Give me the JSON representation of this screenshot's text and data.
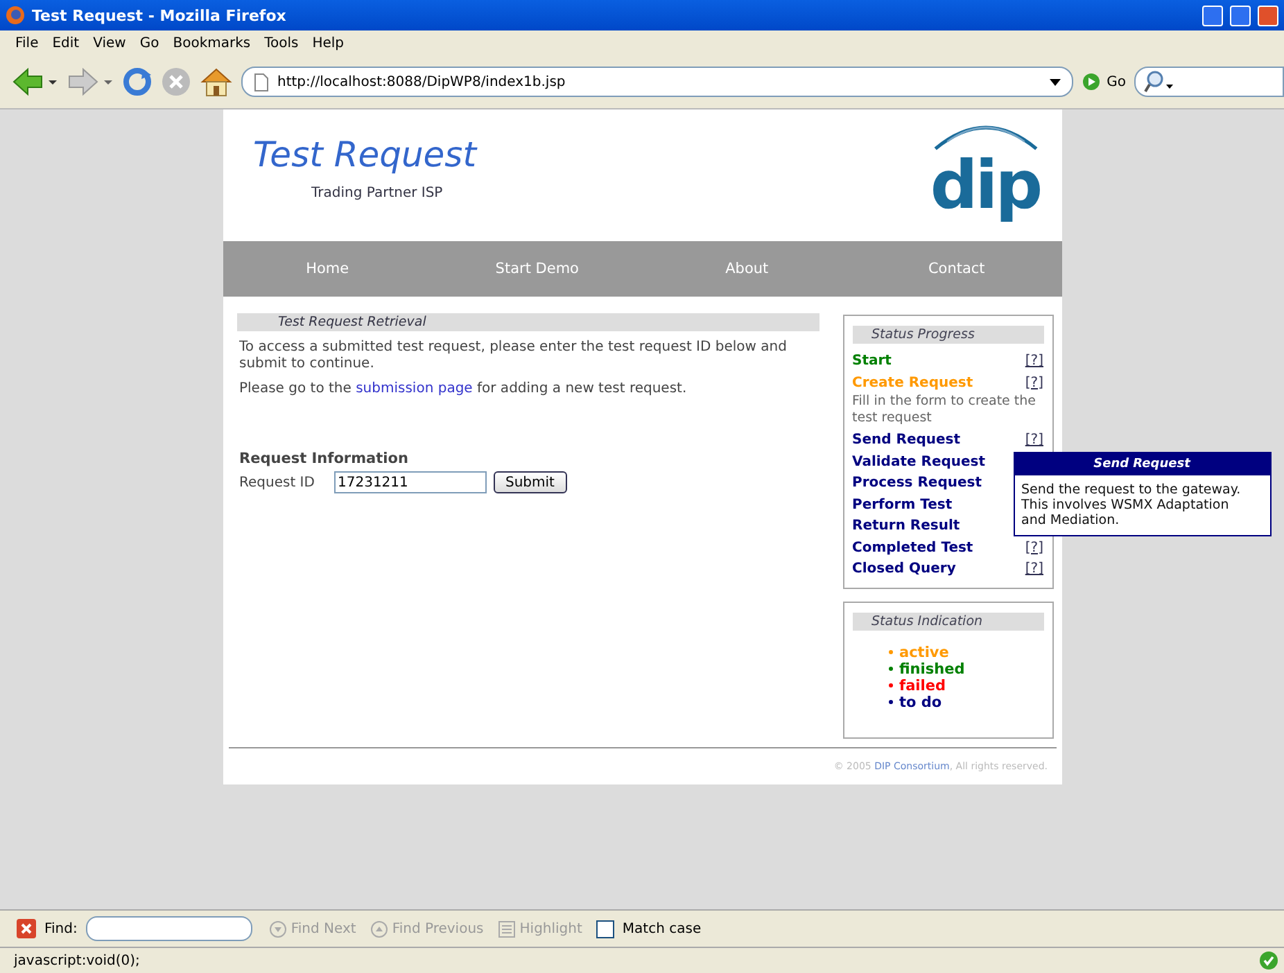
{
  "window": {
    "title": "Test Request - Mozilla Firefox"
  },
  "menu": [
    "File",
    "Edit",
    "View",
    "Go",
    "Bookmarks",
    "Tools",
    "Help"
  ],
  "toolbar": {
    "url": "http://localhost:8088/DipWP8/index1b.jsp",
    "go": "Go"
  },
  "page": {
    "title": "Test Request",
    "subtitle": "Trading Partner ISP",
    "logo": "dip",
    "nav": [
      "Home",
      "Start Demo",
      "About",
      "Contact"
    ],
    "section_title": "Test Request Retrieval",
    "intro": "To access a submitted test request, please enter the test request ID below and submit to continue.",
    "link_sentence": {
      "before": "Please go to the ",
      "link": "submission page",
      "after": " for adding a new test request."
    },
    "form": {
      "heading": "Request Information",
      "label": "Request ID",
      "value": "17231211",
      "button": "Submit"
    },
    "progress": {
      "title": "Status Progress",
      "steps": [
        {
          "label": "Start",
          "color": "#008000",
          "help": "[?]"
        },
        {
          "label": "Create Request",
          "color": "#ff9900",
          "help": "[?]",
          "description": "Fill in the form to create the test request"
        },
        {
          "label": "Send Request",
          "color": "#000080",
          "help": "[?]"
        },
        {
          "label": "Validate Request",
          "color": "#000080"
        },
        {
          "label": "Process Request",
          "color": "#000080"
        },
        {
          "label": "Perform Test",
          "color": "#000080"
        },
        {
          "label": "Return Result",
          "color": "#000080"
        },
        {
          "label": "Completed Test",
          "color": "#000080",
          "help": "[?]"
        },
        {
          "label": "Closed Query",
          "color": "#000080",
          "help": "[?]"
        }
      ]
    },
    "legend": {
      "title": "Status Indication",
      "items": [
        {
          "label": "active",
          "color": "#ff9900"
        },
        {
          "label": "finished",
          "color": "#008000"
        },
        {
          "label": "failed",
          "color": "#ff0000"
        },
        {
          "label": "to do",
          "color": "#000080"
        }
      ]
    },
    "tooltip": {
      "title": "Send Request",
      "text": "Send the request to the gateway. This involves WSMX Adaptation and Mediation."
    },
    "footer": {
      "before": "© 2005 ",
      "link": "DIP Consortium",
      "after": ", All rights reserved."
    }
  },
  "find_bar": {
    "label": "Find:",
    "next": "Find Next",
    "previous": "Find Previous",
    "highlight": "Highlight",
    "match_case": "Match case",
    "match_case_checked": false
  },
  "status_bar": "javascript:void(0);"
}
